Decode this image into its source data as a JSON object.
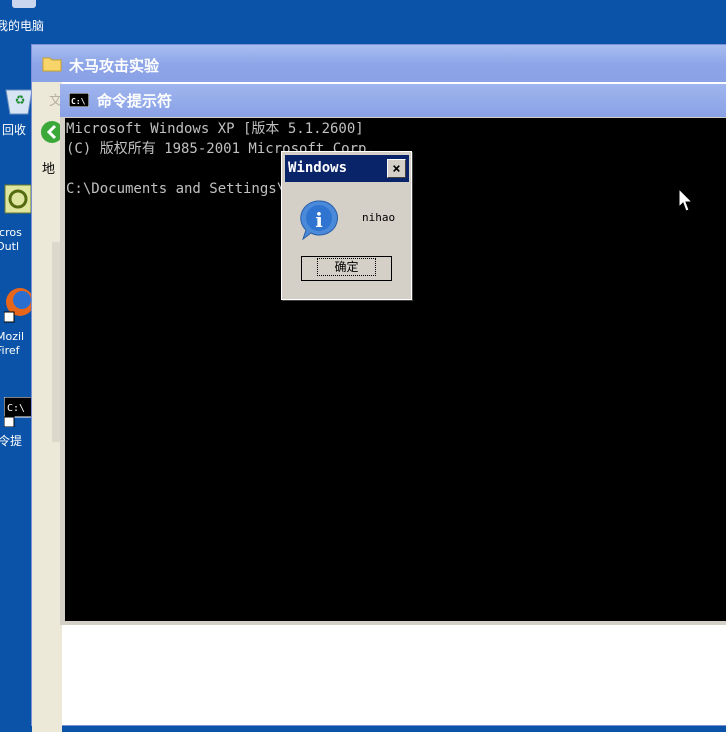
{
  "desktop": {
    "icons": [
      {
        "label": "我的电脑",
        "name": "my-computer"
      },
      {
        "label": "回收",
        "name": "recycle-bin"
      },
      {
        "label": "icros Outl",
        "name": "outlook"
      },
      {
        "label": "Mozil Firef",
        "name": "firefox"
      },
      {
        "label": "令提",
        "name": "command-prompt"
      }
    ]
  },
  "explorer": {
    "title": "木马攻击实验",
    "menu_char": "文",
    "address_char": "地"
  },
  "cmd": {
    "title": "命令提示符",
    "icon_text": "C:\\",
    "lines": [
      "Microsoft Windows XP [版本 5.1.2600]",
      "(C) 版权所有 1985-2001 Microsoft Corp.",
      "",
      "C:\\Documents and Settings\\Administrator>i"
    ]
  },
  "msgbox": {
    "title": "Windows",
    "close_label": "×",
    "message": "nihao",
    "ok_label": "确定",
    "icon": "info-icon"
  },
  "colors": {
    "desktop": "#0a53a8",
    "titlebar_active": "#0a246a",
    "cmd_text": "#c0c0c0"
  }
}
